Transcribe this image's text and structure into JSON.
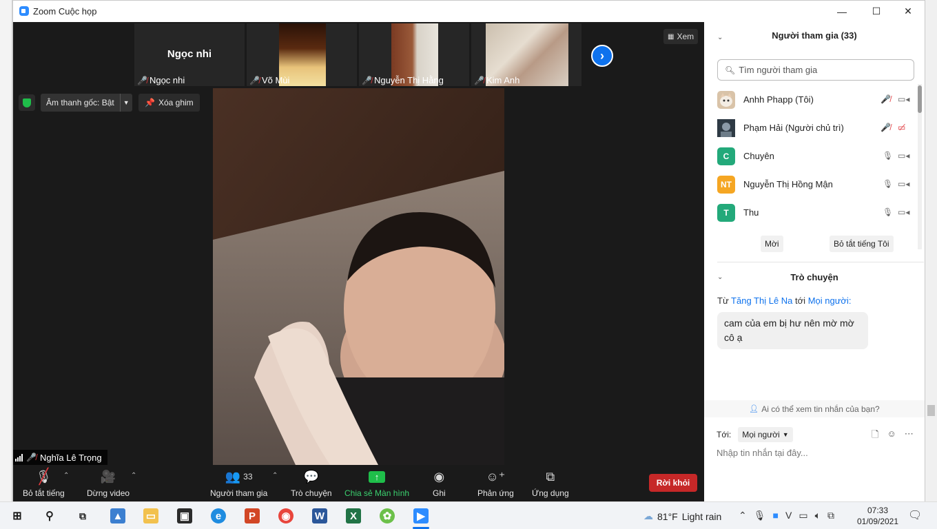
{
  "window": {
    "title": "Zoom Cuộc họp",
    "minimize": "—",
    "maximize": "☐",
    "close": "✕"
  },
  "thumbnails": [
    {
      "name": "Ngọc nhi",
      "big_name": "Ngọc nhi"
    },
    {
      "name": "Võ Mùi"
    },
    {
      "name": "Nguyễn Thị Hằng"
    },
    {
      "name": "Kim Anh"
    }
  ],
  "view_button": "Xem",
  "audio_button": "Âm thanh gốc: Bật",
  "unpin_button": "Xóa ghim",
  "active_speaker": "Nghĩa Lê Trọng",
  "toolbar": {
    "mute": "Bỏ tắt tiếng",
    "video": "Dừng video",
    "participants": "Người tham gia",
    "participant_count": "33",
    "chat": "Trò chuyện",
    "share": "Chia sẻ Màn hình",
    "record": "Ghi",
    "reactions": "Phản ứng",
    "apps": "Ứng dụng",
    "leave": "Rời khỏi"
  },
  "participants_panel": {
    "title": "Người tham gia (33)",
    "search_placeholder": "Tìm người tham gia",
    "list": [
      {
        "name": "Anhh Phapp (Tôi)",
        "avatar": "",
        "color": "#d9c3a8",
        "mic": "muted",
        "video": "on"
      },
      {
        "name": "Phạm Hải (Người chủ trì)",
        "avatar": "",
        "color": "#3b4a5a",
        "mic": "muted",
        "video": "off"
      },
      {
        "name": "Chuyên",
        "avatar": "C",
        "color": "#23a97a",
        "mic": "on",
        "video": "on"
      },
      {
        "name": "Nguyễn Thị Hồng Mận",
        "avatar": "NT",
        "color": "#f5a623",
        "mic": "on",
        "video": "on"
      },
      {
        "name": "Thu",
        "avatar": "T",
        "color": "#23a97a",
        "mic": "on",
        "video": "on"
      }
    ],
    "invite": "Mời",
    "unmute_me": "Bỏ tắt tiếng Tôi"
  },
  "chat_panel": {
    "title": "Trò chuyện",
    "from_prefix": "Từ",
    "from_name": "Tăng Thị Lê Na",
    "to_word": "tới",
    "to_name": "Mọi người:",
    "message": "cam của em bị hư nên mờ mờ cô ạ",
    "notice": "Ai có thể xem tin nhắn của bạn?",
    "to_label": "Tới:",
    "to_select": "Mọi người",
    "input_placeholder": "Nhập tin nhắn tại đây..."
  },
  "taskbar": {
    "temperature": "81°F",
    "weather": "Light rain",
    "time": "07:33",
    "date": "01/09/2021"
  }
}
